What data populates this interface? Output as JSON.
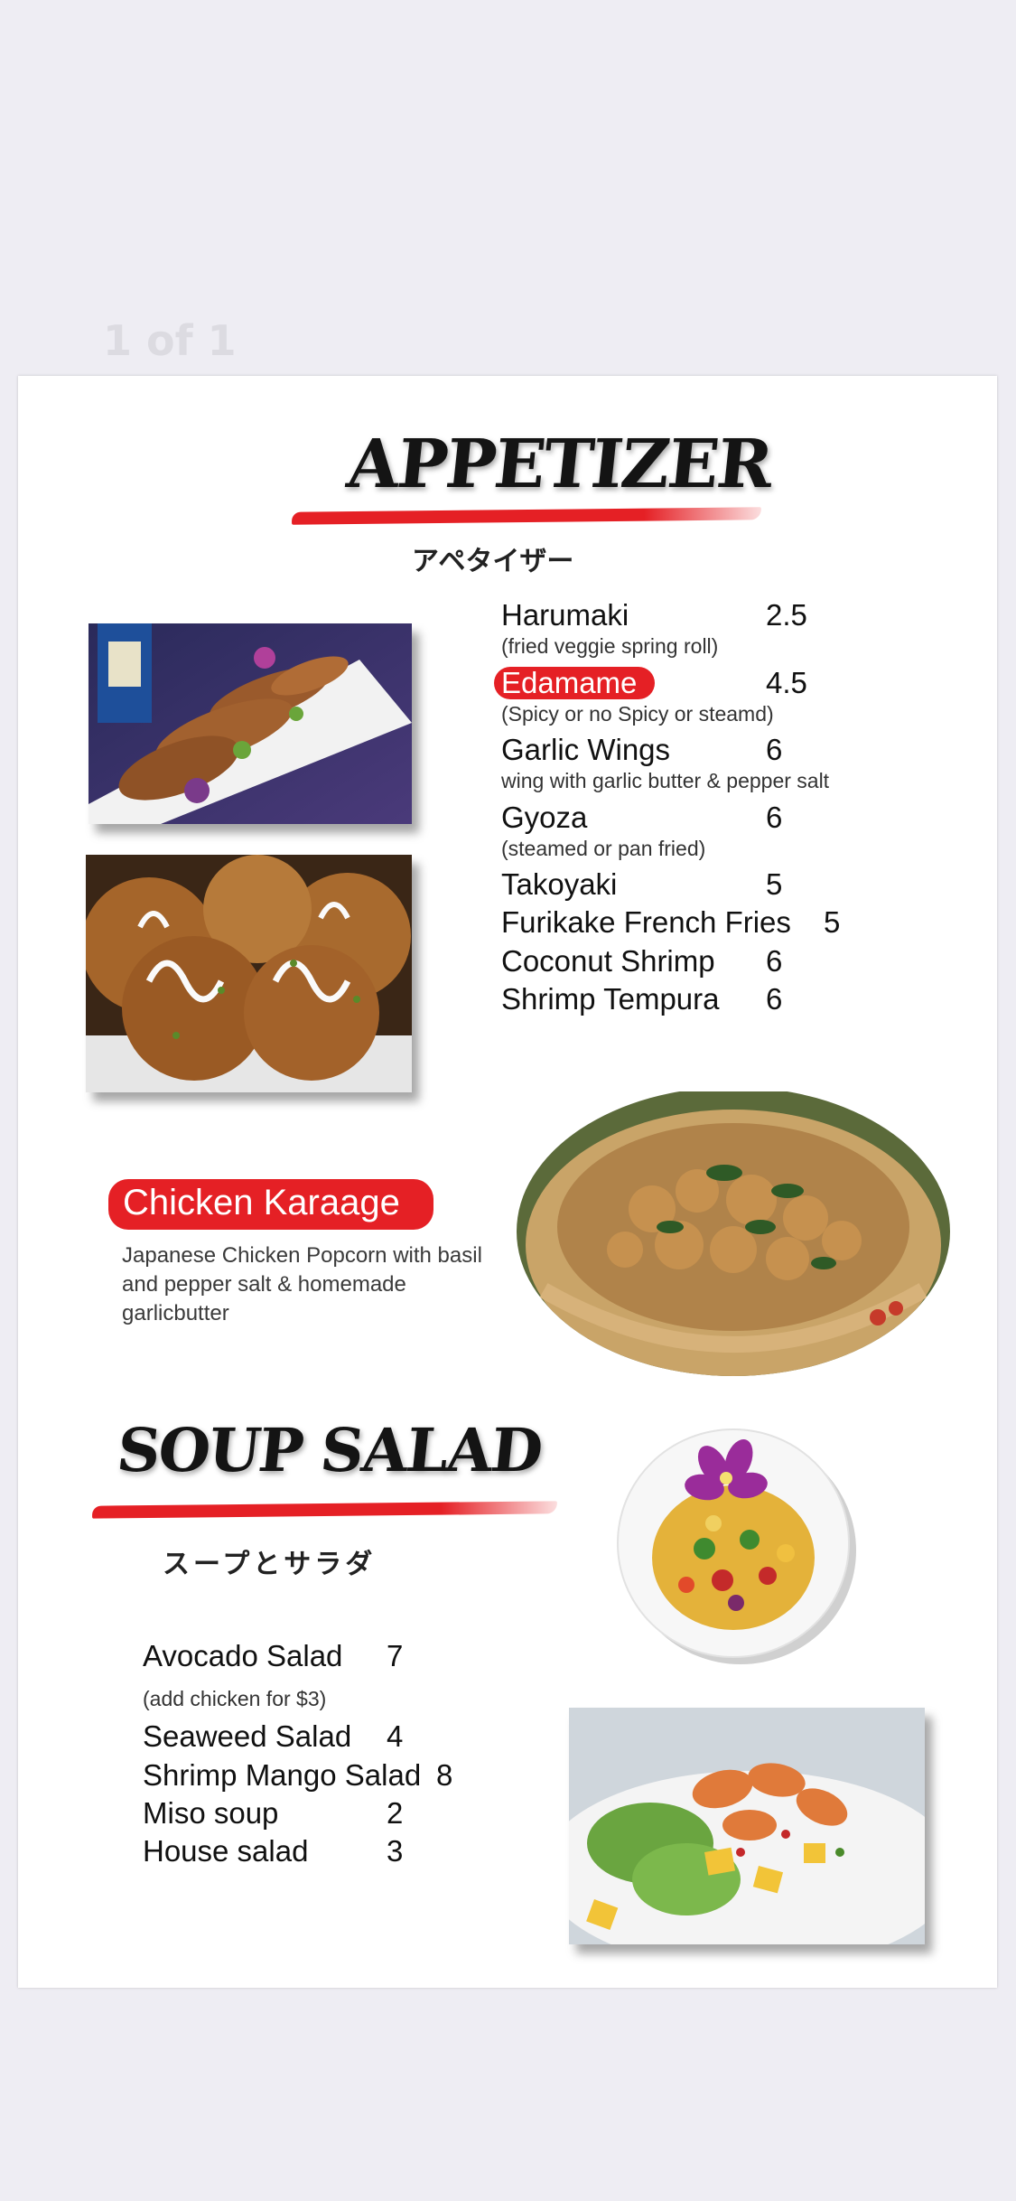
{
  "page_indicator": "1 of 1",
  "appetizer": {
    "title": "APPETIZER",
    "subtitle_jp": "アペタイザー",
    "items": [
      {
        "name": "Harumaki",
        "price": "2.5",
        "desc": "(fried veggie spring roll)"
      },
      {
        "name": "Edamame",
        "price": "4.5",
        "desc": "(Spicy or no Spicy or steamd)",
        "highlight": true
      },
      {
        "name": "Garlic Wings",
        "price": "6",
        "desc": "wing with garlic butter & pepper salt"
      },
      {
        "name": "Gyoza",
        "price": "6",
        "desc": "(steamed or pan fried)"
      },
      {
        "name": "Takoyaki",
        "price": "5"
      },
      {
        "name": "Furikake French Fries",
        "price": "5"
      },
      {
        "name": "Coconut Shrimp",
        "price": "6"
      },
      {
        "name": "Shrimp Tempura",
        "price": "6"
      }
    ]
  },
  "feature": {
    "name": "Chicken Karaage",
    "desc": "Japanese Chicken Popcorn with basil and pepper salt & homemade garlicbutter"
  },
  "soup_salad": {
    "title": "SOUP SALAD",
    "subtitle_jp": "スープとサラダ",
    "items": [
      {
        "name": "Avocado Salad",
        "price": "7"
      },
      {
        "name": "Shrimp Mango Salad",
        "price": "8"
      },
      {
        "name": "Seaweed Salad",
        "price": "4"
      },
      {
        "name": "Miso soup",
        "price": "2"
      },
      {
        "name": "House salad",
        "price": "3"
      }
    ],
    "avocado_note": "(add chicken for $3)"
  },
  "colors": {
    "accent_red": "#e52025",
    "text": "#111111",
    "background": "#eeedf3"
  }
}
